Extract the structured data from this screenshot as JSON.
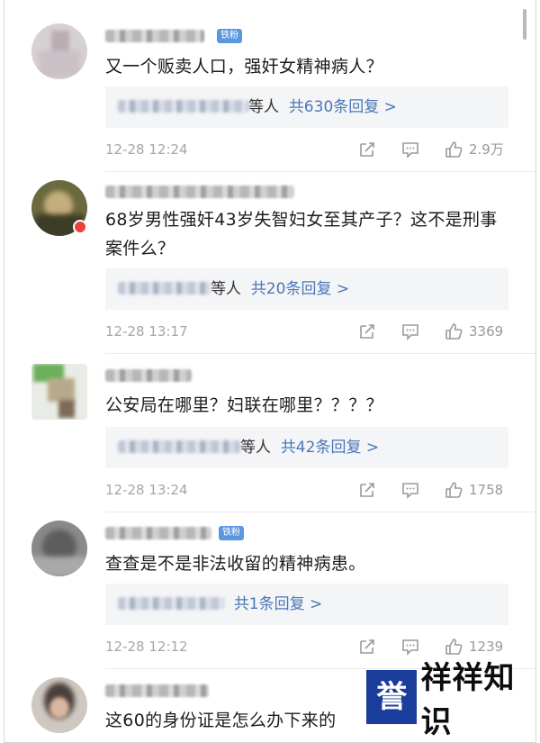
{
  "comments": [
    {
      "text": "又一个贩卖人口，强奸女精神病人？",
      "fan_badge": "铁粉",
      "reply_people": "等人",
      "reply_link": "共630条回复 >",
      "time": "12-28 12:24",
      "likes": "2.9万"
    },
    {
      "text": "68岁男性强奸43岁失智妇女至其产子？这不是刑事案件么？",
      "reply_people": "等人",
      "reply_link": "共20条回复 >",
      "time": "12-28 13:17",
      "likes": "3369"
    },
    {
      "text": "公安局在哪里？妇联在哪里？？？？",
      "reply_people": "等人",
      "reply_link": "共42条回复 >",
      "time": "12-28 13:24",
      "likes": "1758"
    },
    {
      "text": "查查是不是非法收留的精神病患。",
      "fan_badge": "铁粉",
      "reply_link": "共1条回复 >",
      "time": "12-28 12:12",
      "likes": "1239"
    },
    {
      "text": "这60的身份证是怎么办下来的"
    }
  ],
  "icons": {
    "share": "share-icon",
    "comment": "comment-icon",
    "like": "thumbs-up-icon"
  },
  "watermark": {
    "box": "誉",
    "text": "祥祥知识"
  },
  "colors": {
    "link": "#4a77b8",
    "badge": "#5a97de",
    "watermark": "#1a3c9b"
  }
}
